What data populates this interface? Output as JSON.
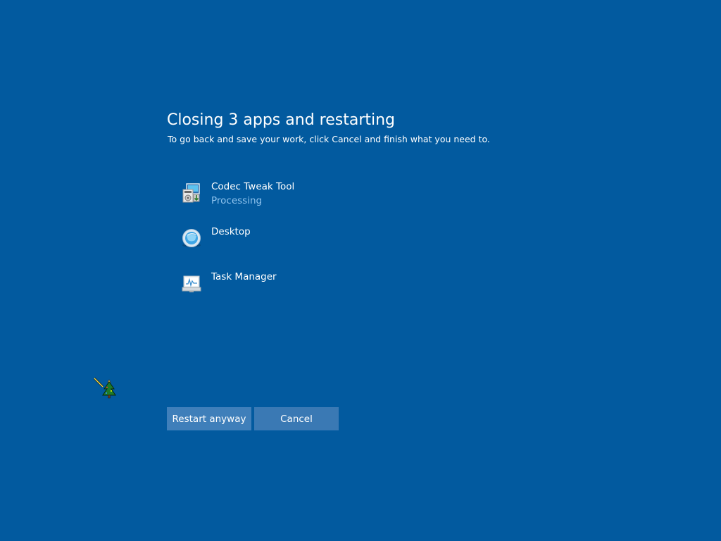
{
  "dialog": {
    "title": "Closing 3 apps and restarting",
    "subtitle": "To go back and save your work, click Cancel and finish what you need to."
  },
  "apps": [
    {
      "name": "Codec Tweak Tool",
      "status": "Processing",
      "icon": "installer-icon"
    },
    {
      "name": "Desktop",
      "status": "",
      "icon": "desktop-globe-icon"
    },
    {
      "name": "Task Manager",
      "status": "",
      "icon": "task-manager-icon"
    }
  ],
  "buttons": {
    "restart_label": "Restart anyway",
    "cancel_label": "Cancel"
  },
  "cursor": {
    "icon": "christmas-tree-busy-cursor-icon"
  },
  "colors": {
    "background": "#025a9f",
    "button": "#3a7ebb",
    "status_text": "#8fc3ee",
    "text": "#ffffff"
  }
}
